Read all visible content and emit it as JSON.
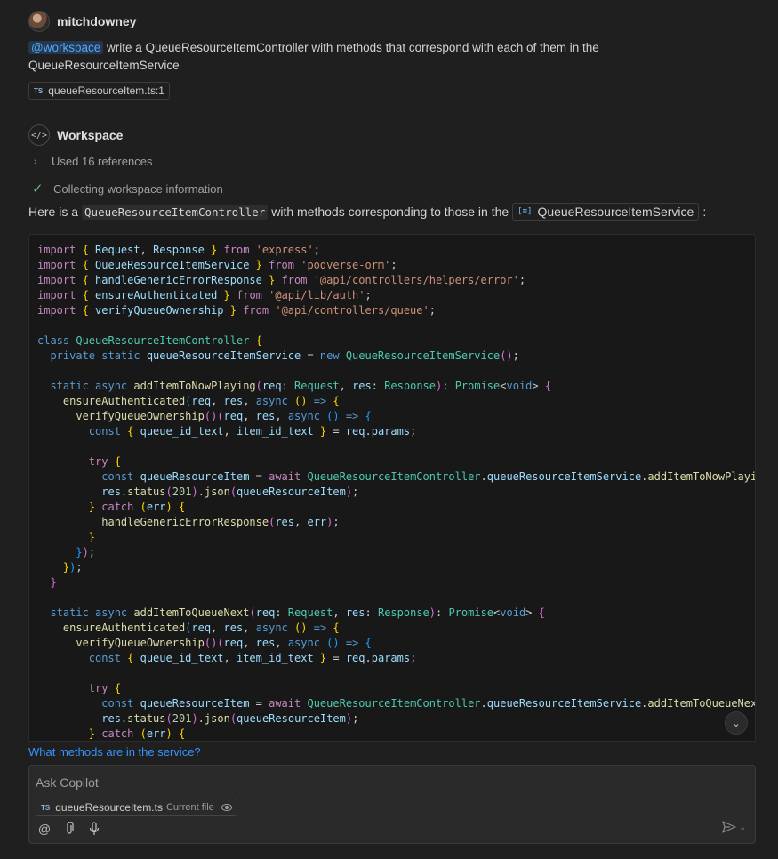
{
  "user": {
    "name": "mitchdowney"
  },
  "prompt": {
    "mention": "@workspace",
    "text": " write a QueueResourceItemController with methods that correspond with each of them in the QueueResourceItemService"
  },
  "attached_file": {
    "badge": "TS",
    "label": "queueResourceItem.ts:1"
  },
  "response": {
    "agent_name": "Workspace",
    "references_label": "Used 16 references",
    "status_label": "Collecting workspace information",
    "intro_before": "Here is a",
    "intro_code": "QueueResourceItemController",
    "intro_middle": "with methods corresponding to those in the",
    "intro_symbol": "QueueResourceItemService",
    "intro_after": ":"
  },
  "code": {
    "lines": [
      [
        [
          "kw",
          "import "
        ],
        [
          "br1",
          "{ "
        ],
        [
          "var",
          "Request"
        ],
        [
          "pl",
          ", "
        ],
        [
          "var",
          "Response"
        ],
        [
          "br1",
          " }"
        ],
        [
          "kw",
          " from "
        ],
        [
          "str",
          "'express'"
        ],
        [
          "pl",
          ";"
        ]
      ],
      [
        [
          "kw",
          "import "
        ],
        [
          "br1",
          "{ "
        ],
        [
          "var",
          "QueueResourceItemService"
        ],
        [
          "br1",
          " }"
        ],
        [
          "kw",
          " from "
        ],
        [
          "str",
          "'podverse-orm'"
        ],
        [
          "pl",
          ";"
        ]
      ],
      [
        [
          "kw",
          "import "
        ],
        [
          "br1",
          "{ "
        ],
        [
          "var",
          "handleGenericErrorResponse"
        ],
        [
          "br1",
          " }"
        ],
        [
          "kw",
          " from "
        ],
        [
          "str",
          "'@api/controllers/helpers/error'"
        ],
        [
          "pl",
          ";"
        ]
      ],
      [
        [
          "kw",
          "import "
        ],
        [
          "br1",
          "{ "
        ],
        [
          "var",
          "ensureAuthenticated"
        ],
        [
          "br1",
          " }"
        ],
        [
          "kw",
          " from "
        ],
        [
          "str",
          "'@api/lib/auth'"
        ],
        [
          "pl",
          ";"
        ]
      ],
      [
        [
          "kw",
          "import "
        ],
        [
          "br1",
          "{ "
        ],
        [
          "var",
          "verifyQueueOwnership"
        ],
        [
          "br1",
          " }"
        ],
        [
          "kw",
          " from "
        ],
        [
          "str",
          "'@api/controllers/queue'"
        ],
        [
          "pl",
          ";"
        ]
      ],
      [],
      [
        [
          "kw2",
          "class "
        ],
        [
          "cls",
          "QueueResourceItemController"
        ],
        [
          "br1",
          " {"
        ]
      ],
      [
        [
          "kw2",
          "  private static "
        ],
        [
          "var",
          "queueResourceItemService"
        ],
        [
          "pl",
          " = "
        ],
        [
          "kw2",
          "new "
        ],
        [
          "cls",
          "QueueResourceItemService"
        ],
        [
          "br2",
          "()"
        ],
        [
          "pl",
          ";"
        ]
      ],
      [],
      [
        [
          "kw2",
          "  static async "
        ],
        [
          "fn",
          "addItemToNowPlaying"
        ],
        [
          "br2",
          "("
        ],
        [
          "var",
          "req"
        ],
        [
          "pl",
          ": "
        ],
        [
          "cls",
          "Request"
        ],
        [
          "pl",
          ", "
        ],
        [
          "var",
          "res"
        ],
        [
          "pl",
          ": "
        ],
        [
          "cls",
          "Response"
        ],
        [
          "br2",
          ")"
        ],
        [
          "pl",
          ": "
        ],
        [
          "cls",
          "Promise"
        ],
        [
          "pl",
          "<"
        ],
        [
          "kw2",
          "void"
        ],
        [
          "pl",
          "> "
        ],
        [
          "br2",
          "{"
        ]
      ],
      [
        [
          "fn",
          "    ensureAuthenticated"
        ],
        [
          "br3",
          "("
        ],
        [
          "var",
          "req"
        ],
        [
          "pl",
          ", "
        ],
        [
          "var",
          "res"
        ],
        [
          "pl",
          ", "
        ],
        [
          "kw2",
          "async "
        ],
        [
          "br1",
          "()"
        ],
        [
          "kw2",
          " => "
        ],
        [
          "br1",
          "{"
        ]
      ],
      [
        [
          "fn",
          "      verifyQueueOwnership"
        ],
        [
          "br2",
          "()("
        ],
        [
          "var",
          "req"
        ],
        [
          "pl",
          ", "
        ],
        [
          "var",
          "res"
        ],
        [
          "pl",
          ", "
        ],
        [
          "kw2",
          "async "
        ],
        [
          "br3",
          "()"
        ],
        [
          "kw2",
          " => "
        ],
        [
          "br3",
          "{"
        ]
      ],
      [
        [
          "kw2",
          "        const "
        ],
        [
          "br1",
          "{ "
        ],
        [
          "var",
          "queue_id_text"
        ],
        [
          "pl",
          ", "
        ],
        [
          "var",
          "item_id_text"
        ],
        [
          "br1",
          " }"
        ],
        [
          "pl",
          " = "
        ],
        [
          "var",
          "req"
        ],
        [
          "pl",
          "."
        ],
        [
          "var",
          "params"
        ],
        [
          "pl",
          ";"
        ]
      ],
      [],
      [
        [
          "kw",
          "        try "
        ],
        [
          "br1",
          "{"
        ]
      ],
      [
        [
          "kw2",
          "          const "
        ],
        [
          "var",
          "queueResourceItem"
        ],
        [
          "pl",
          " = "
        ],
        [
          "kw",
          "await "
        ],
        [
          "cls",
          "QueueResourceItemController"
        ],
        [
          "pl",
          "."
        ],
        [
          "var",
          "queueResourceItemService"
        ],
        [
          "pl",
          "."
        ],
        [
          "fn",
          "addItemToNowPlaying"
        ],
        [
          "br2",
          "("
        ]
      ],
      [
        [
          "var",
          "          res"
        ],
        [
          "pl",
          "."
        ],
        [
          "fn",
          "status"
        ],
        [
          "br2",
          "("
        ],
        [
          "num",
          "201"
        ],
        [
          "br2",
          ")"
        ],
        [
          "pl",
          "."
        ],
        [
          "fn",
          "json"
        ],
        [
          "br2",
          "("
        ],
        [
          "var",
          "queueResourceItem"
        ],
        [
          "br2",
          ")"
        ],
        [
          "pl",
          ";"
        ]
      ],
      [
        [
          "br1",
          "        }"
        ],
        [
          "kw",
          " catch "
        ],
        [
          "br1",
          "("
        ],
        [
          "var",
          "err"
        ],
        [
          "br1",
          ") {"
        ]
      ],
      [
        [
          "fn",
          "          handleGenericErrorResponse"
        ],
        [
          "br2",
          "("
        ],
        [
          "var",
          "res"
        ],
        [
          "pl",
          ", "
        ],
        [
          "var",
          "err"
        ],
        [
          "br2",
          ")"
        ],
        [
          "pl",
          ";"
        ]
      ],
      [
        [
          "br1",
          "        }"
        ]
      ],
      [
        [
          "br3",
          "      }"
        ],
        [
          "br2",
          ")"
        ],
        [
          "pl",
          ";"
        ]
      ],
      [
        [
          "br1",
          "    }"
        ],
        [
          "br3",
          ")"
        ],
        [
          "pl",
          ";"
        ]
      ],
      [
        [
          "br2",
          "  }"
        ]
      ],
      [],
      [
        [
          "kw2",
          "  static async "
        ],
        [
          "fn",
          "addItemToQueueNext"
        ],
        [
          "br2",
          "("
        ],
        [
          "var",
          "req"
        ],
        [
          "pl",
          ": "
        ],
        [
          "cls",
          "Request"
        ],
        [
          "pl",
          ", "
        ],
        [
          "var",
          "res"
        ],
        [
          "pl",
          ": "
        ],
        [
          "cls",
          "Response"
        ],
        [
          "br2",
          ")"
        ],
        [
          "pl",
          ": "
        ],
        [
          "cls",
          "Promise"
        ],
        [
          "pl",
          "<"
        ],
        [
          "kw2",
          "void"
        ],
        [
          "pl",
          "> "
        ],
        [
          "br2",
          "{"
        ]
      ],
      [
        [
          "fn",
          "    ensureAuthenticated"
        ],
        [
          "br3",
          "("
        ],
        [
          "var",
          "req"
        ],
        [
          "pl",
          ", "
        ],
        [
          "var",
          "res"
        ],
        [
          "pl",
          ", "
        ],
        [
          "kw2",
          "async "
        ],
        [
          "br1",
          "()"
        ],
        [
          "kw2",
          " => "
        ],
        [
          "br1",
          "{"
        ]
      ],
      [
        [
          "fn",
          "      verifyQueueOwnership"
        ],
        [
          "br2",
          "()("
        ],
        [
          "var",
          "req"
        ],
        [
          "pl",
          ", "
        ],
        [
          "var",
          "res"
        ],
        [
          "pl",
          ", "
        ],
        [
          "kw2",
          "async "
        ],
        [
          "br3",
          "()"
        ],
        [
          "kw2",
          " => "
        ],
        [
          "br3",
          "{"
        ]
      ],
      [
        [
          "kw2",
          "        const "
        ],
        [
          "br1",
          "{ "
        ],
        [
          "var",
          "queue_id_text"
        ],
        [
          "pl",
          ", "
        ],
        [
          "var",
          "item_id_text"
        ],
        [
          "br1",
          " }"
        ],
        [
          "pl",
          " = "
        ],
        [
          "var",
          "req"
        ],
        [
          "pl",
          "."
        ],
        [
          "var",
          "params"
        ],
        [
          "pl",
          ";"
        ]
      ],
      [],
      [
        [
          "kw",
          "        try "
        ],
        [
          "br1",
          "{"
        ]
      ],
      [
        [
          "kw2",
          "          const "
        ],
        [
          "var",
          "queueResourceItem"
        ],
        [
          "pl",
          " = "
        ],
        [
          "kw",
          "await "
        ],
        [
          "cls",
          "QueueResourceItemController"
        ],
        [
          "pl",
          "."
        ],
        [
          "var",
          "queueResourceItemService"
        ],
        [
          "pl",
          "."
        ],
        [
          "fn",
          "addItemToQueueNext"
        ],
        [
          "br2",
          "("
        ]
      ],
      [
        [
          "var",
          "          res"
        ],
        [
          "pl",
          "."
        ],
        [
          "fn",
          "status"
        ],
        [
          "br2",
          "("
        ],
        [
          "num",
          "201"
        ],
        [
          "br2",
          ")"
        ],
        [
          "pl",
          "."
        ],
        [
          "fn",
          "json"
        ],
        [
          "br2",
          "("
        ],
        [
          "var",
          "queueResourceItem"
        ],
        [
          "br2",
          ")"
        ],
        [
          "pl",
          ";"
        ]
      ],
      [
        [
          "br1",
          "        }"
        ],
        [
          "kw",
          " catch "
        ],
        [
          "br1",
          "("
        ],
        [
          "var",
          "err"
        ],
        [
          "br1",
          ") {"
        ]
      ]
    ]
  },
  "suggestion": "What methods are in the service?",
  "input": {
    "placeholder": "Ask Copilot",
    "context_badge": "TS",
    "context_file": "queueResourceItem.ts",
    "context_sub": "Current file"
  },
  "icons": {
    "mention": "at-icon",
    "attach": "paperclip-icon",
    "mic": "microphone-icon",
    "send": "send-icon"
  }
}
